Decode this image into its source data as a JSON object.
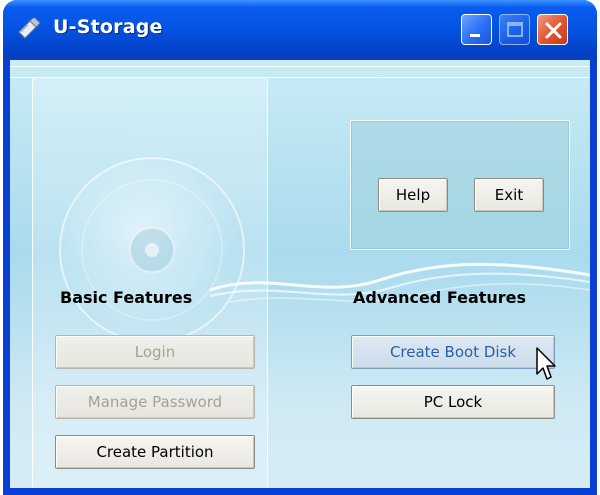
{
  "window": {
    "title": "U-Storage",
    "controls": {
      "minimize": "minimize-icon",
      "maximize": "maximize-icon",
      "close": "close-icon"
    }
  },
  "basic": {
    "title": "Basic Features",
    "buttons": {
      "login": "Login",
      "manage_password": "Manage Password",
      "create_partition": "Create Partition"
    }
  },
  "advanced": {
    "title": "Advanced Features",
    "buttons": {
      "create_boot_disk": "Create Boot Disk",
      "pc_lock": "PC Lock"
    }
  },
  "utility": {
    "help": "Help",
    "exit": "Exit"
  },
  "colors": {
    "titlebar": "#0554e3",
    "client_bg": "#b9e3f1",
    "close_button": "#e0542e",
    "hover_text": "#2a5ea8"
  }
}
